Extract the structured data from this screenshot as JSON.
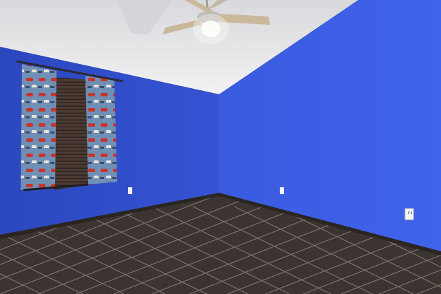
{
  "scene": {
    "type": "empty-bedroom-photo",
    "colors": {
      "wall_left": "#2f4fcf",
      "wall_right": "#3a5ee3",
      "ceiling": "#e9e9ec",
      "floor_tile": "#3b3431",
      "grout": "#7c736c",
      "baseboard": "#2b2522",
      "blind": "#4a3a34"
    },
    "icons": [
      "ceiling-fan-icon",
      "window-icon",
      "curtain-icon",
      "outlet-icon"
    ]
  }
}
